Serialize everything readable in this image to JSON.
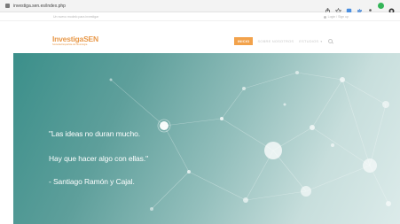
{
  "browser": {
    "url": "investiga.sen.es/index.php",
    "icons": [
      "share-icon",
      "star-icon",
      "extension-icon",
      "puzzle-icon",
      "profile-icon",
      "sync-icon",
      "menu-icon"
    ]
  },
  "topbar": {
    "tagline": "Un nuevo modelo para investigar",
    "login": "Login / Sign up"
  },
  "header": {
    "logo_main": "Investiga",
    "logo_accent": "SEN",
    "logo_sub": "Sociedad Española de Neurología",
    "nav": [
      {
        "label": "INICIO",
        "active": true
      },
      {
        "label": "SOBRE NOSOTROS",
        "active": false
      },
      {
        "label": "ESTUDIOS",
        "active": false
      }
    ],
    "accent_color": "#f2a24b"
  },
  "hero": {
    "quote_line1": "\"Las ideas no duran mucho.",
    "quote_line2": "Hay que hacer algo con ellas.\"",
    "author": "- Santiago Ramón y Cajal."
  }
}
